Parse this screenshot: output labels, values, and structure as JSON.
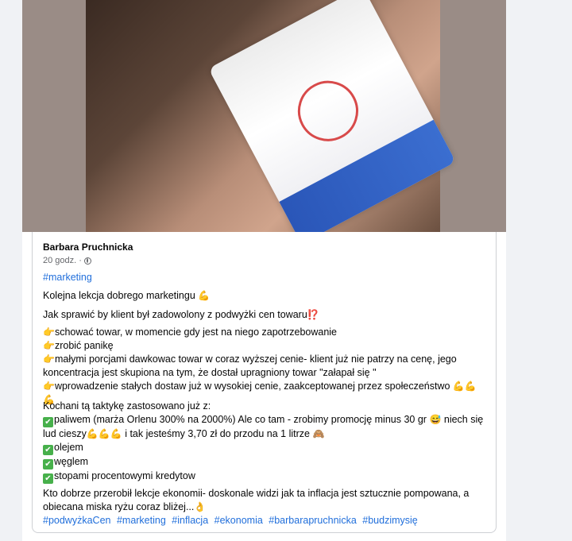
{
  "post": {
    "author": "Barbara Pruchnicka",
    "time": "20 godz.",
    "separator": "·",
    "hashtag_top": "#marketing",
    "line1": "Kolejna lekcja dobrego marketingu",
    "line2": "Jak sprawić by klient był zadowolony z podwyżki cen towaru",
    "bullets": [
      "schować towar, w momencie gdy jest na niego zapotrzebowanie",
      "zrobić panikę",
      "małymi porcjami dawkowac towar w coraz wyższej cenie- klient już nie patrzy na cenę, jego koncentracja jest skupiona na tym, że dostał upragniony towar \"załapał się \"",
      "wprowadzenie stałych dostaw już w wysokiej cenie, zaakceptowanej przez społeczeństwo"
    ],
    "applied_intro": "Kochani tą taktykę zastosowano już z:",
    "checks": [
      "paliwem (marża Orlenu 300% na 2000%) Ale co tam - zrobimy promocję minus 30 gr",
      "niech się lud cieszy",
      "i tak jesteśmy 3,70 zł do przodu na 1 litrze",
      "olejem",
      "węglem",
      "stopami procentowymi kredytow"
    ],
    "closing": "Kto dobrze przerobił lekcje ekonomii- doskonale widzi jak ta inflacja jest sztucznie pompowana, a obiecana miska ryżu coraz bliżej...",
    "tags": [
      "#podwyżkaCen",
      "#marketing",
      "#inflacja",
      "#ekonomia",
      "#barbarapruchnicka",
      "#budzimysię"
    ]
  },
  "icons": {
    "globe": "globe-icon",
    "muscle": "💪",
    "pointing": "👉",
    "exclamation": "⁉️",
    "check": "✅",
    "smile": "😅",
    "monkey": "🙈",
    "ok_hand": "👌"
  },
  "emoji": {
    "muscle": "💪",
    "muscle3": "💪💪💪",
    "pointing": "👉",
    "exclamation": "⁉️",
    "smile": "😅",
    "monkey": "🙈",
    "ok_hand": "👌",
    "check": "✔"
  }
}
